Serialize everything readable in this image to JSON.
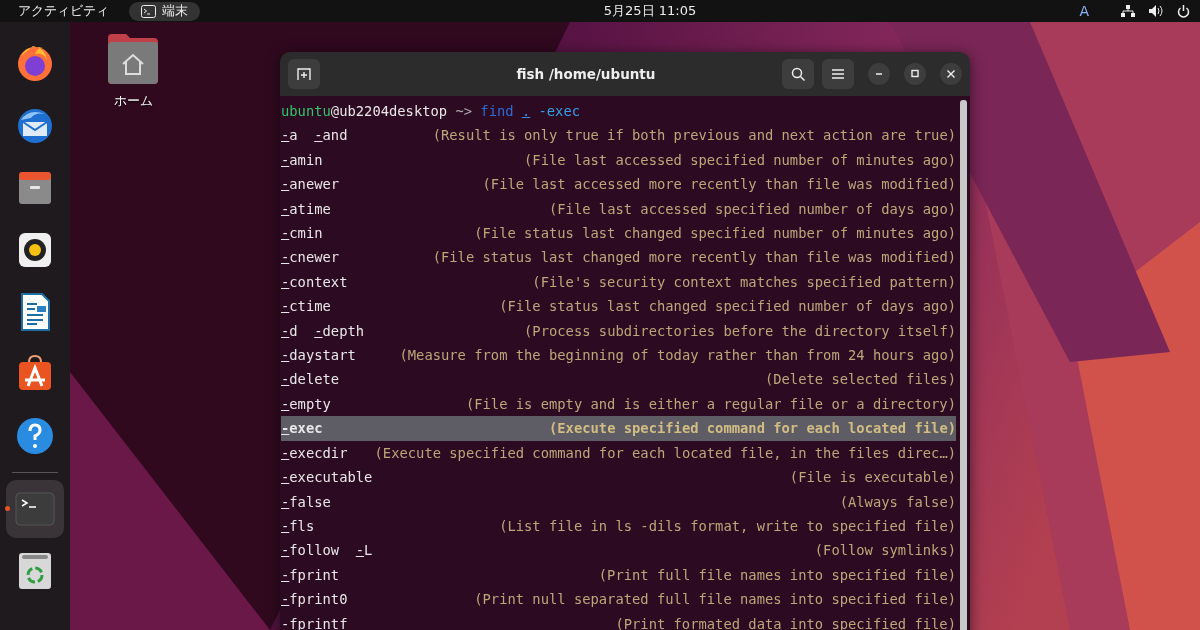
{
  "top_bar": {
    "activities": "アクティビティ",
    "app_menu": {
      "label": "端末"
    },
    "clock": "5月25日 11:05",
    "keyboard": "A"
  },
  "dock": {
    "items": [
      {
        "kind": "browser",
        "running": false
      },
      {
        "kind": "mail",
        "running": false
      },
      {
        "kind": "files",
        "running": false
      },
      {
        "kind": "music",
        "running": false
      },
      {
        "kind": "writer",
        "running": false
      },
      {
        "kind": "store",
        "running": false
      },
      {
        "kind": "help",
        "running": false
      },
      {
        "kind": "separator"
      },
      {
        "kind": "terminal",
        "running": true
      },
      {
        "kind": "trash",
        "running": false
      }
    ]
  },
  "desktop_icons": [
    {
      "label": "ホーム"
    }
  ],
  "terminal": {
    "title": "fish /home/ubuntu",
    "prompt": [
      {
        "kind": "user",
        "text": "ubuntu"
      },
      {
        "kind": "host",
        "text": "@ub2204desktop"
      },
      {
        "kind": "arrow",
        "text": "~>"
      },
      {
        "kind": "command",
        "text": "find"
      },
      {
        "kind": "path",
        "text": "."
      },
      {
        "kind": "option",
        "text": "-exec"
      }
    ],
    "completions": [
      {
        "options": [
          "-a",
          "-and"
        ],
        "description": "(Result is only true if both previous and next action are true)",
        "selected": false
      },
      {
        "options": [
          "-amin"
        ],
        "description": "(File last accessed specified number of minutes ago)",
        "selected": false
      },
      {
        "options": [
          "-anewer"
        ],
        "description": "(File last accessed more recently than file was modified)",
        "selected": false
      },
      {
        "options": [
          "-atime"
        ],
        "description": "(File last accessed specified number of days ago)",
        "selected": false
      },
      {
        "options": [
          "-cmin"
        ],
        "description": "(File status last changed specified number of minutes ago)",
        "selected": false
      },
      {
        "options": [
          "-cnewer"
        ],
        "description": "(File status last changed more recently than file was modified)",
        "selected": false
      },
      {
        "options": [
          "-context"
        ],
        "description": "(File's security context matches specified pattern)",
        "selected": false
      },
      {
        "options": [
          "-ctime"
        ],
        "description": "(File status last changed specified number of days ago)",
        "selected": false
      },
      {
        "options": [
          "-d",
          "-depth"
        ],
        "description": "(Process subdirectories before the directory itself)",
        "selected": false
      },
      {
        "options": [
          "-daystart"
        ],
        "description": "(Measure from the beginning of today rather than from 24 hours ago)",
        "selected": false
      },
      {
        "options": [
          "-delete"
        ],
        "description": "(Delete selected files)",
        "selected": false
      },
      {
        "options": [
          "-empty"
        ],
        "description": "(File is empty and is either a regular file or a directory)",
        "selected": false
      },
      {
        "options": [
          "-exec"
        ],
        "description": "(Execute specified command for each located file)",
        "selected": true
      },
      {
        "options": [
          "-execdir"
        ],
        "description": "(Execute specified command for each located file, in the files direc…)",
        "selected": false
      },
      {
        "options": [
          "-executable"
        ],
        "description": "(File is executable)",
        "selected": false
      },
      {
        "options": [
          "-false"
        ],
        "description": "(Always false)",
        "selected": false
      },
      {
        "options": [
          "-fls"
        ],
        "description": "(List file in ls -dils format, write to specified file)",
        "selected": false
      },
      {
        "options": [
          "-follow",
          "-L"
        ],
        "description": "(Follow symlinks)",
        "selected": false
      },
      {
        "options": [
          "-fprint"
        ],
        "description": "(Print full file names into specified file)",
        "selected": false
      },
      {
        "options": [
          "-fprint0"
        ],
        "description": "(Print null separated full file names into specified file)",
        "selected": false
      },
      {
        "options": [
          "-fprintf"
        ],
        "description": "(Print formated data into specified file)",
        "selected": false
      }
    ]
  }
}
